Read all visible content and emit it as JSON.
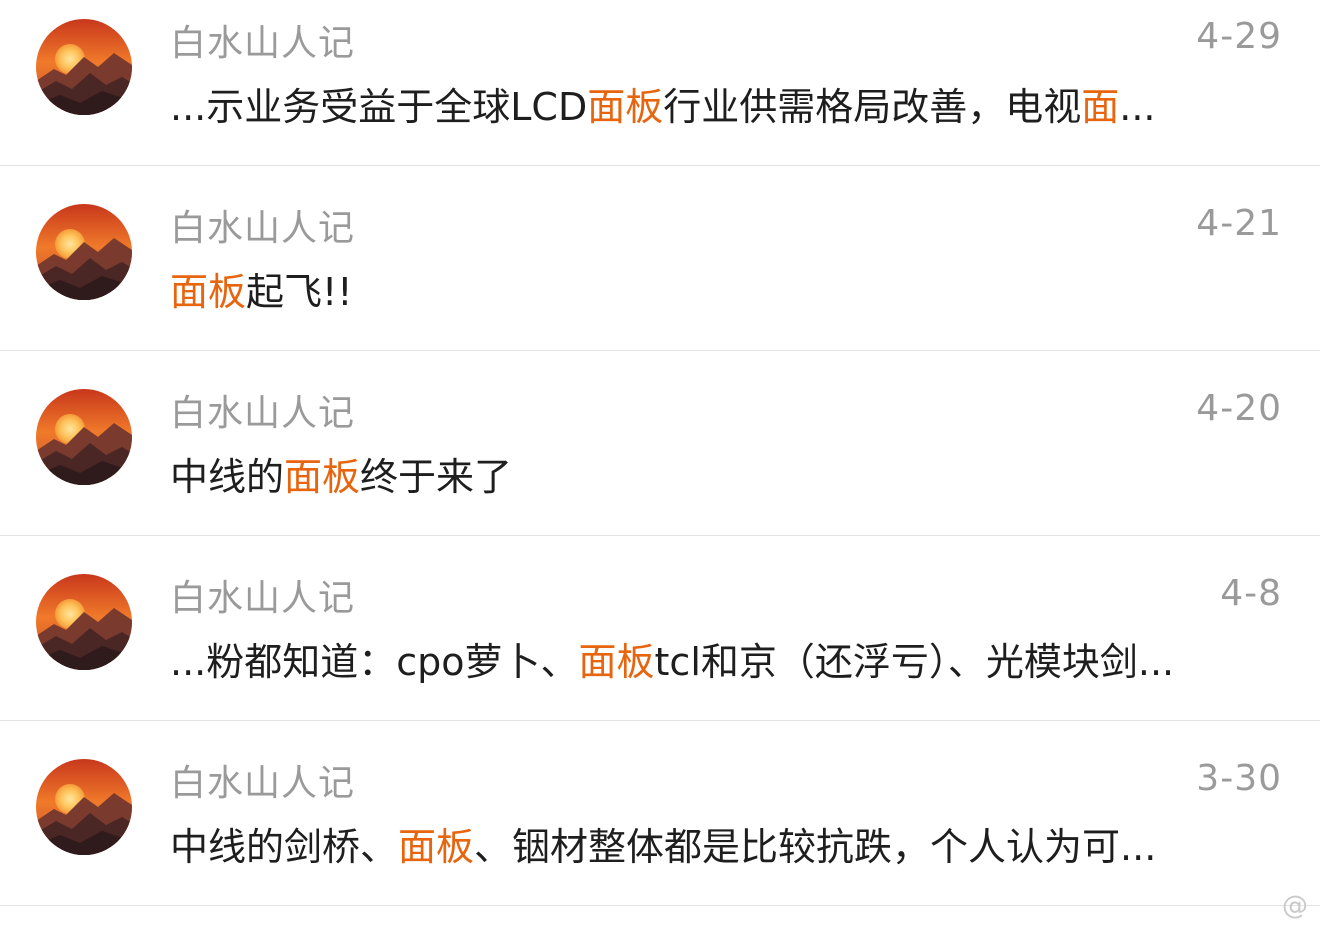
{
  "colors": {
    "highlight": "#e8650f",
    "meta_text": "#9a9a9a",
    "body_text": "#1e1e1e",
    "divider": "#e3e3e3"
  },
  "avatar_icon": "sunset-mountain-avatar-icon",
  "results": [
    {
      "author": "白水山人记",
      "date": "4-29",
      "snippet": {
        "t0": "...示业务受益于全球LCD",
        "h0": "面板",
        "t1": "行业供需格局改善，电视",
        "h1": "面",
        "t2": "..."
      }
    },
    {
      "author": "白水山人记",
      "date": "4-21",
      "snippet": {
        "t0": "",
        "h0": "面板",
        "t1": "起飞!!",
        "h1": "",
        "t2": ""
      }
    },
    {
      "author": "白水山人记",
      "date": "4-20",
      "snippet": {
        "t0": "中线的",
        "h0": "面板",
        "t1": "终于来了",
        "h1": "",
        "t2": ""
      }
    },
    {
      "author": "白水山人记",
      "date": "4-8",
      "snippet": {
        "t0": "...粉都知道：cpo萝卜、",
        "h0": "面板",
        "t1": "tcl和京（还浮亏）、光模块剑...",
        "h1": "",
        "t2": ""
      }
    },
    {
      "author": "白水山人记",
      "date": "3-30",
      "snippet": {
        "t0": "中线的剑桥、",
        "h0": "面板",
        "t1": "、铟材整体都是比较抗跌，个人认为可...",
        "h1": "",
        "t2": ""
      }
    }
  ],
  "watermark": "@"
}
